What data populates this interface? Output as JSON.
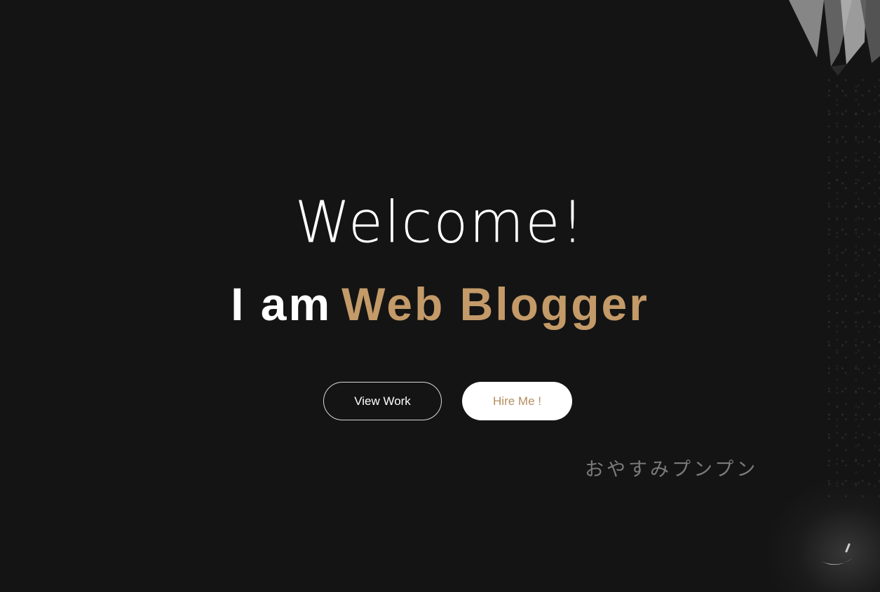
{
  "hero": {
    "greeting": "Welcome!",
    "role_prefix": "I am",
    "role_highlight": "Web Blogger",
    "buttons": {
      "view_work": "View Work",
      "hire_me": "Hire Me !"
    }
  },
  "background": {
    "japanese_text": "おやすみプンプン"
  },
  "colors": {
    "background": "#141414",
    "accent": "#c39a68",
    "text": "#ffffff",
    "button_hire_text": "#b58d5f"
  }
}
